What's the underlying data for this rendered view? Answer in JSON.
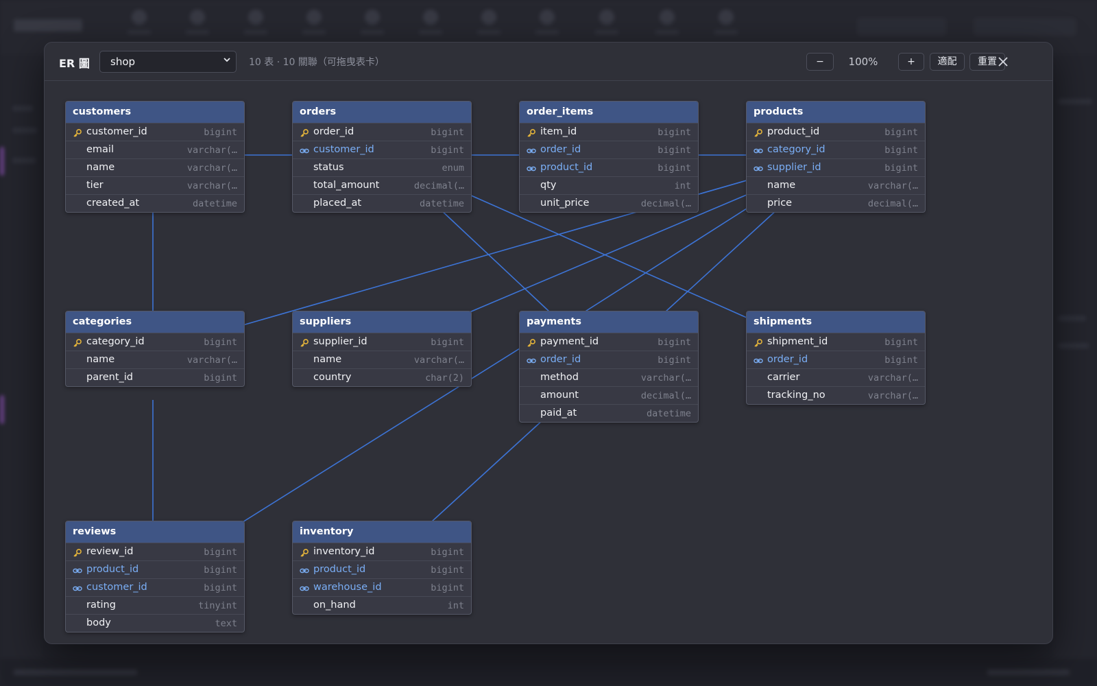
{
  "dialog": {
    "title": "ER 圖",
    "database": "shop",
    "summary": "10 表 · 10 關聯（可拖曳表卡）",
    "zoom_out_label": "−",
    "zoom_level": "100%",
    "zoom_in_label": "+",
    "fit_label": "適配",
    "reset_label": "重置"
  },
  "colors": {
    "header": "#3f5585",
    "link": "#3d74d6",
    "fk_text": "#7aaef5",
    "pk_icon": "#e4b43a"
  },
  "tables": [
    {
      "name": "customers",
      "columns": [
        {
          "name": "customer_id",
          "type": "bigint",
          "key": "pk"
        },
        {
          "name": "email",
          "type": "varchar(…",
          "key": ""
        },
        {
          "name": "name",
          "type": "varchar(…",
          "key": ""
        },
        {
          "name": "tier",
          "type": "varchar(…",
          "key": ""
        },
        {
          "name": "created_at",
          "type": "datetime",
          "key": ""
        }
      ]
    },
    {
      "name": "orders",
      "columns": [
        {
          "name": "order_id",
          "type": "bigint",
          "key": "pk"
        },
        {
          "name": "customer_id",
          "type": "bigint",
          "key": "fk"
        },
        {
          "name": "status",
          "type": "enum",
          "key": ""
        },
        {
          "name": "total_amount",
          "type": "decimal(…",
          "key": ""
        },
        {
          "name": "placed_at",
          "type": "datetime",
          "key": ""
        }
      ]
    },
    {
      "name": "order_items",
      "columns": [
        {
          "name": "item_id",
          "type": "bigint",
          "key": "pk"
        },
        {
          "name": "order_id",
          "type": "bigint",
          "key": "fk"
        },
        {
          "name": "product_id",
          "type": "bigint",
          "key": "fk"
        },
        {
          "name": "qty",
          "type": "int",
          "key": ""
        },
        {
          "name": "unit_price",
          "type": "decimal(…",
          "key": ""
        }
      ]
    },
    {
      "name": "products",
      "columns": [
        {
          "name": "product_id",
          "type": "bigint",
          "key": "pk"
        },
        {
          "name": "category_id",
          "type": "bigint",
          "key": "fk"
        },
        {
          "name": "supplier_id",
          "type": "bigint",
          "key": "fk"
        },
        {
          "name": "name",
          "type": "varchar(…",
          "key": ""
        },
        {
          "name": "price",
          "type": "decimal(…",
          "key": ""
        }
      ]
    },
    {
      "name": "categories",
      "columns": [
        {
          "name": "category_id",
          "type": "bigint",
          "key": "pk"
        },
        {
          "name": "name",
          "type": "varchar(…",
          "key": ""
        },
        {
          "name": "parent_id",
          "type": "bigint",
          "key": ""
        }
      ]
    },
    {
      "name": "suppliers",
      "columns": [
        {
          "name": "supplier_id",
          "type": "bigint",
          "key": "pk"
        },
        {
          "name": "name",
          "type": "varchar(…",
          "key": ""
        },
        {
          "name": "country",
          "type": "char(2)",
          "key": ""
        }
      ]
    },
    {
      "name": "payments",
      "columns": [
        {
          "name": "payment_id",
          "type": "bigint",
          "key": "pk"
        },
        {
          "name": "order_id",
          "type": "bigint",
          "key": "fk"
        },
        {
          "name": "method",
          "type": "varchar(…",
          "key": ""
        },
        {
          "name": "amount",
          "type": "decimal(…",
          "key": ""
        },
        {
          "name": "paid_at",
          "type": "datetime",
          "key": ""
        }
      ]
    },
    {
      "name": "shipments",
      "columns": [
        {
          "name": "shipment_id",
          "type": "bigint",
          "key": "pk"
        },
        {
          "name": "order_id",
          "type": "bigint",
          "key": "fk"
        },
        {
          "name": "carrier",
          "type": "varchar(…",
          "key": ""
        },
        {
          "name": "tracking_no",
          "type": "varchar(…",
          "key": ""
        }
      ]
    },
    {
      "name": "reviews",
      "columns": [
        {
          "name": "review_id",
          "type": "bigint",
          "key": "pk"
        },
        {
          "name": "product_id",
          "type": "bigint",
          "key": "fk"
        },
        {
          "name": "customer_id",
          "type": "bigint",
          "key": "fk"
        },
        {
          "name": "rating",
          "type": "tinyint",
          "key": ""
        },
        {
          "name": "body",
          "type": "text",
          "key": ""
        }
      ]
    },
    {
      "name": "inventory",
      "columns": [
        {
          "name": "inventory_id",
          "type": "bigint",
          "key": "pk"
        },
        {
          "name": "product_id",
          "type": "bigint",
          "key": "fk"
        },
        {
          "name": "warehouse_id",
          "type": "bigint",
          "key": "fk"
        },
        {
          "name": "on_hand",
          "type": "int",
          "key": ""
        }
      ]
    }
  ],
  "relations": [
    {
      "from": "orders",
      "to": "customers"
    },
    {
      "from": "order_items",
      "to": "orders"
    },
    {
      "from": "order_items",
      "to": "products"
    },
    {
      "from": "products",
      "to": "categories"
    },
    {
      "from": "products",
      "to": "suppliers"
    },
    {
      "from": "payments",
      "to": "orders"
    },
    {
      "from": "shipments",
      "to": "orders"
    },
    {
      "from": "reviews",
      "to": "products"
    },
    {
      "from": "reviews",
      "to": "customers"
    },
    {
      "from": "inventory",
      "to": "products"
    }
  ]
}
